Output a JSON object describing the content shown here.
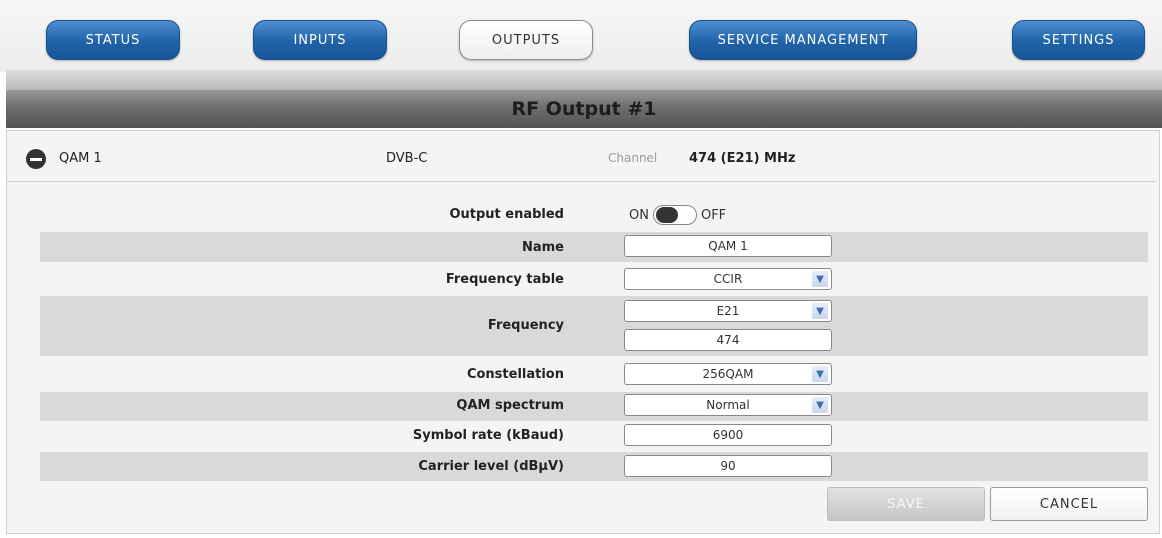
{
  "nav": {
    "status": "STATUS",
    "inputs": "INPUTS",
    "outputs": "OUTPUTS",
    "service_management": "SERVICE MANAGEMENT",
    "settings": "SETTINGS"
  },
  "page_title": "RF Output #1",
  "output_header": {
    "name": "QAM 1",
    "standard": "DVB-C",
    "channel_label": "Channel",
    "channel_value": "474 (E21) MHz"
  },
  "form": {
    "output_enabled": {
      "label": "Output enabled",
      "on": "ON",
      "off": "OFF"
    },
    "name": {
      "label": "Name",
      "value": "QAM 1"
    },
    "frequency_table": {
      "label": "Frequency table",
      "value": "CCIR"
    },
    "frequency": {
      "label": "Frequency",
      "channel": "E21",
      "value": "474"
    },
    "constellation": {
      "label": "Constellation",
      "value": "256QAM"
    },
    "qam_spectrum": {
      "label": "QAM spectrum",
      "value": "Normal"
    },
    "symbol_rate": {
      "label": "Symbol rate (kBaud)",
      "value": "6900"
    },
    "carrier_level": {
      "label": "Carrier level (dBµV)",
      "value": "90"
    }
  },
  "buttons": {
    "save": "SAVE",
    "cancel": "CANCEL"
  }
}
